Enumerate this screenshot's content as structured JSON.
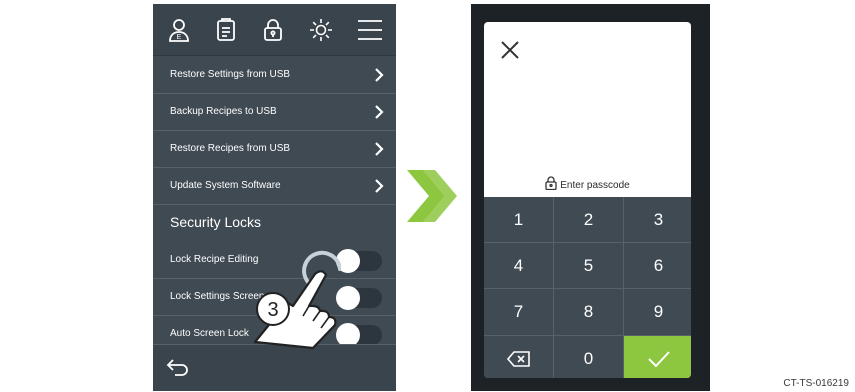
{
  "left_screen": {
    "topbar_icons": [
      "user-icon",
      "document-icon",
      "lock-icon",
      "brightness-icon",
      "menu-icon"
    ],
    "menu_items": [
      {
        "label": "Restore Settings from USB"
      },
      {
        "label": "Backup Recipes to USB"
      },
      {
        "label": "Restore Recipes from USB"
      },
      {
        "label": "Update System Software"
      }
    ],
    "section_title": "Security Locks",
    "toggles": [
      {
        "label": "Lock Recipe Editing",
        "state": "off"
      },
      {
        "label": "Lock Settings Screen",
        "state": "off"
      },
      {
        "label": "Auto Screen Lock",
        "state": "off"
      }
    ],
    "back_icon": "back-arrow-icon",
    "step_marker": "3"
  },
  "transition_icon": "double-chevron-right-icon",
  "right_screen": {
    "close_icon": "close-icon",
    "prompt": "Enter passcode",
    "keys": [
      "1",
      "2",
      "3",
      "4",
      "5",
      "6",
      "7",
      "8",
      "9",
      "",
      "0",
      ""
    ],
    "backspace_icon": "backspace-icon",
    "confirm_icon": "checkmark-icon"
  },
  "document_code": "CT-TS-016219",
  "colors": {
    "panel": "#3f4a53",
    "accent_green": "#8dc63f",
    "text_light": "#ffffff"
  }
}
